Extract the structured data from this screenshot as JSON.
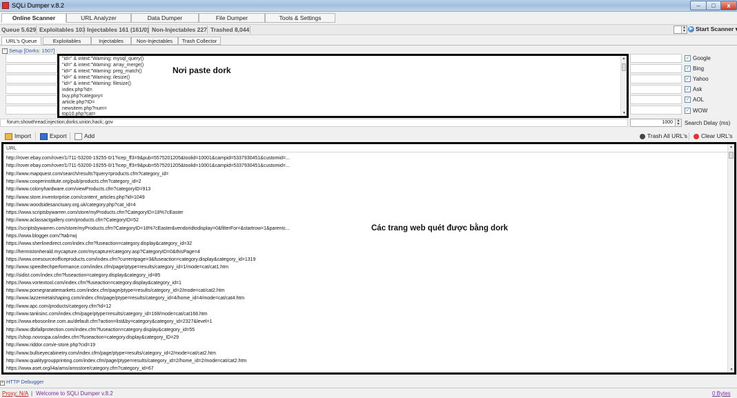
{
  "window": {
    "title": "SQLi Dumper v.8.2",
    "min": "–",
    "max": "□",
    "close": "x"
  },
  "main_tabs": [
    "Online Scanner",
    "URL Analyzer",
    "Data Dumper",
    "File Dumper",
    "Tools & Settings"
  ],
  "stats": {
    "queue": "Queue 5.629",
    "exploitables": "Exploitables 103",
    "injectables": "Injectables 161 (161/0)",
    "non_injectables": "Non-Injectables 227",
    "trashed": "Trashed 8,044",
    "threads": "1",
    "start_scanner": "Start Scanner ▾"
  },
  "sub_tabs": [
    "URL's Queue",
    "Exploitables",
    "Injectables",
    "Non-Injectables",
    "Trash Collector"
  ],
  "setup": {
    "label": "Setup [Dorks: 1507]",
    "toggle": "−"
  },
  "dorks": [
    "\"id=\" & intext:\"Warning: mysql_query()",
    "\"id=\" & intext:\"Warning: array_merge()",
    "\"id=\" & intext:\"Warning: preg_match()",
    "\"id=\" & intext:\"Warning: ilesize()",
    "\"id=\" & intext:\"Warning: filesize()",
    "index.php?id=",
    "buy.php?category=",
    "article.php?ID=",
    "newsitem.php?num=",
    "top10.php?cat="
  ],
  "annotations": {
    "dork": "Nơi paste dork",
    "urls": "Các trang web quét được bằng dork"
  },
  "engines": [
    {
      "name": "Google",
      "checked": true
    },
    {
      "name": "Bing",
      "checked": true
    },
    {
      "name": "Yahoo",
      "checked": true
    },
    {
      "name": "Ask",
      "checked": true
    },
    {
      "name": "AOL",
      "checked": true
    },
    {
      "name": "WOW",
      "checked": true
    }
  ],
  "exclude_words": "forum;showthread;injection;dorks;union;hack;.gov",
  "search_delay": {
    "value": "1000",
    "label": "Search Delay (ms)"
  },
  "toolbar": {
    "import": "Import",
    "export": "Export",
    "add": "Add",
    "trash_all": "Trash All URL's",
    "clear": "Clear URL's"
  },
  "url_table": {
    "header": "URL",
    "rows": [
      "http://rover.ebay.com/rover/1/711-53200-19255-0/1?icep_ff3=9&pub=5575201205&toolid=10001&campid=5337930451&customid=...",
      "http://rover.ebay.com/rover/1/711-53200-19255-0/1?icep_ff3=9&pub=5575201205&toolid=10001&campid=5337930451&customid=...",
      "http://www.mapquest.com/search/results?query=products.cfm?category_id=",
      "http://www.cooperinstitute.org/pub/products.cfm?category_id=2",
      "http://www.colonyhardware.com/viewProducts.cfm?categoryID=913",
      "http://www.store.inventorprise.com/content_articles.php?id=1049",
      "http://www.woodsidesanctuary.org.uk/category.php?cat_id=4",
      "https://www.scriptsbywarren.com/store/myProducts.cfm?CategoryID=18%7cEaster",
      "http://www.aclassactgallery.com/products.cfm?CategoryID=52",
      "https://scriptsbywarren.com/store/myProducts.cfm?CategoryID=18%7cEaster&vendoridtodisplay=0&filterFor=&startrow=1&parentc...",
      "https://www.blogger.com/?tab=wj",
      "https://www.sherlinedirect.com/index.cfm?fuseaction=category.display&category_id=32",
      "http://hermistonherald.mycapture.com/mycapture/category.asp?CategoryID=0&thisPage=4",
      "https://www.onesourceofficeproducts.com/index.cfm?currentpage=3&fuseaction=category.display&category_id=1319",
      "http://www.speedtechperformance.com/index.cfm/page/ptype=results/category_id=1/mode=cat/cat1.htm",
      "http://sidist.com/index.cfm?fuseaction=category.display&category_id=85",
      "https://www.vortextool.com/index.cfm?fuseaction=category.display&category_id=1",
      "http://www.pomegranatemarkets.com/index.cfm/page/ptype=results/category_id=2/mode=cat/cat2.htm",
      "http://www.lazzemetalshaping.com/index.cfm/page/ptype=results/category_id=4/home_id=4/mode=cat/cat4.htm",
      "http://www.apc.com/products/category.cfm?id=12",
      "http://www.tanksinc.com/index.cfm/page/ptype=results/category_id=168/mode=cat/cat168.htm",
      "https://www.ebosonline.com.au/default.cfm?action=list&by=category&category_id=2327&level=1",
      "http://www.dbifallprotection.com/index.cfm?fuseaction=category.display&category_id=55",
      "https://shop.novospa.ca/index.cfm?fuseaction=category.display&category_ID=29",
      "http://www.riddor.com/e-store.php?cid=19",
      "http://www.bullseyecabinetry.com/index.cfm/page/ptype=results/category_id=2/mode=cat/cat2.htm",
      "http://www.qualitygroupprinting.com/index.cfm/page/ptype=results/category_id=2/home_id=2/mode=cat/cat2.htm",
      "https://www.aset.org/i4a/ams/amsstore/category.cfm?category_id=67"
    ]
  },
  "bottom": {
    "http_debugger": "HTTP Debugger",
    "proxy": "Proxy: N/A",
    "welcome": "Welcome to SQLi Dumper v.8.2",
    "bytes": "0 Bytes"
  },
  "colors": {
    "annotation_border": "#000000",
    "link_blue": "#2a55a4",
    "status_purple": "#7a2aa0"
  }
}
